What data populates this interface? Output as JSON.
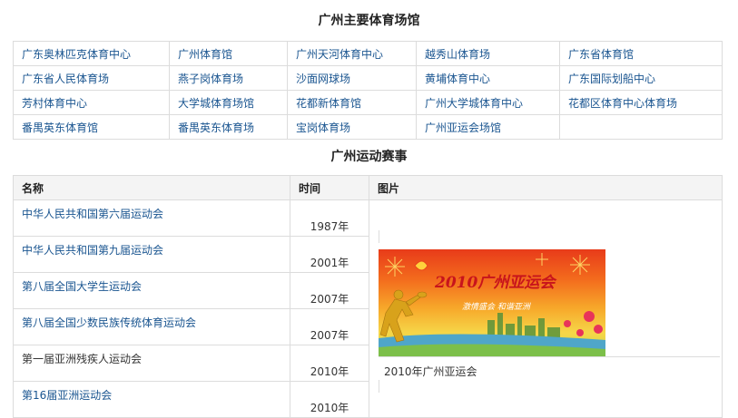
{
  "sections": {
    "venues_title": "广州主要体育场馆",
    "events_title": "广州运动赛事"
  },
  "venues": [
    [
      "广东奥林匹克体育中心",
      "广州体育馆",
      "广州天河体育中心",
      "越秀山体育场",
      "广东省体育馆"
    ],
    [
      "广东省人民体育场",
      "燕子岗体育场",
      "沙面网球场",
      "黄埔体育中心",
      "广东国际划船中心"
    ],
    [
      "芳村体育中心",
      "大学城体育场馆",
      "花都新体育馆",
      "广州大学城体育中心",
      "花都区体育中心体育场"
    ],
    [
      "番禺英东体育馆",
      "番禺英东体育场",
      "宝岗体育场",
      "广州亚运会场馆",
      ""
    ]
  ],
  "events_table": {
    "headers": {
      "name": "名称",
      "time": "时间",
      "picture": "图片"
    },
    "rows": [
      {
        "name": "中华人民共和国第六届运动会",
        "year": "1987年",
        "linked": true
      },
      {
        "name": "中华人民共和国第九届运动会",
        "year": "2001年",
        "linked": true
      },
      {
        "name": "第八届全国大学生运动会",
        "year": "2007年",
        "linked": true
      },
      {
        "name": "第八届全国少数民族传统体育运动会",
        "year": "2007年",
        "linked": true
      },
      {
        "name": "第一届亚洲残疾人运动会",
        "year": "2010年",
        "linked": false
      },
      {
        "name": "第16届亚洲运动会",
        "year": "2010年",
        "linked": true
      }
    ],
    "picture": {
      "banner_title": "2010广州亚运会",
      "banner_slogan": "激情盛会  和谐亚洲",
      "caption": "2010年广州亚运会"
    }
  },
  "colors": {
    "link": "#1a5590",
    "border": "#dcdcdc",
    "header_bg": "#f4f4f4"
  }
}
